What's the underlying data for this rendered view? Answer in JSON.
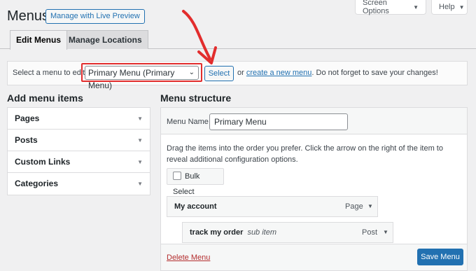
{
  "screen_meta": {
    "screen_options_label": "Screen Options",
    "help_label": "Help"
  },
  "page": {
    "title": "Menus",
    "live_preview_label": "Manage with Live Preview"
  },
  "tabs": [
    {
      "label": "Edit Menus",
      "active": true
    },
    {
      "label": "Manage Locations",
      "active": false
    }
  ],
  "manage_bar": {
    "prompt": "Select a menu to edit:",
    "selected_menu": "Primary Menu (Primary Menu)",
    "select_button": "Select",
    "or_text": "or",
    "create_link": "create a new menu",
    "suffix": ". Do not forget to save your changes!"
  },
  "add_items": {
    "heading": "Add menu items",
    "sections": [
      "Pages",
      "Posts",
      "Custom Links",
      "Categories"
    ]
  },
  "structure": {
    "heading": "Menu structure",
    "name_label": "Menu Name",
    "name_value": "Primary Menu",
    "instructions": "Drag the items into the order you prefer. Click the arrow on the right of the item to reveal additional configuration options.",
    "bulk_select": "Bulk Select",
    "items": [
      {
        "title": "My account",
        "type": "Page",
        "sub_label": ""
      },
      {
        "title": "track my order",
        "type": "Post",
        "sub_label": "sub item"
      }
    ],
    "delete_label": "Delete Menu",
    "save_label": "Save Menu"
  },
  "colors": {
    "accent": "#2271b1",
    "highlight": "#e22d2d",
    "danger": "#b32d2e"
  }
}
